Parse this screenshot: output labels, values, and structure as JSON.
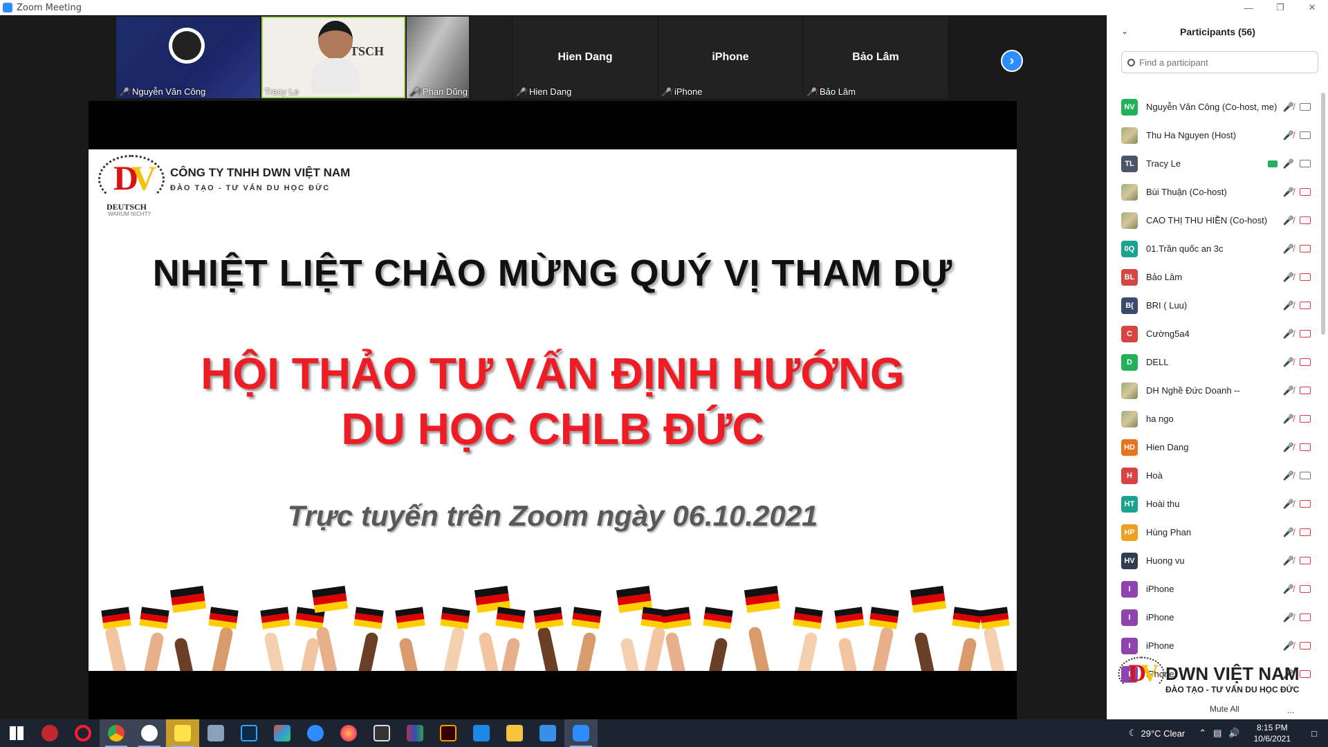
{
  "window": {
    "title": "Zoom Meeting"
  },
  "video_strip": [
    {
      "name": "Nguyễn Văn Công",
      "muted": true
    },
    {
      "name": "Tracy Le",
      "muted": false,
      "speaking": true,
      "overlay_text": "TSCH"
    },
    {
      "name": "Phan Dũng",
      "muted": true
    },
    {
      "name": "Hien Dang",
      "muted": true,
      "center_label": "Hien Dang"
    },
    {
      "name": "iPhone",
      "muted": true,
      "center_label": "iPhone"
    },
    {
      "name": "Bảo Lâm",
      "muted": true,
      "center_label": "Bảo Lâm"
    }
  ],
  "slide": {
    "company_name": "CÔNG TY TNHH DWN VIỆT NAM",
    "company_sub": "ĐÀO TẠO - TƯ VẤN DU HỌC ĐỨC",
    "logo_text": "DEUTSCH",
    "logo_sub": "WARUM NICHT?",
    "line1": "NHIỆT LIỆT CHÀO MỪNG  QUÝ  VỊ THAM DỰ",
    "line2a": "HỘI THẢO TƯ VẤN ĐỊNH HƯỚNG",
    "line2b": "DU HỌC CHLB ĐỨC",
    "line3": "Trực tuyến trên Zoom ngày 06.10.2021"
  },
  "participants_panel": {
    "title": "Participants (56)",
    "search_placeholder": "Find a participant",
    "participants": [
      {
        "initials": "NV",
        "color": "#23b05b",
        "name": "Nguyễn Văn Công (Co-host, me)",
        "video": "on"
      },
      {
        "initials": "",
        "color": "photo",
        "name": "Thu Ha Nguyen (Host)",
        "video": "on"
      },
      {
        "initials": "TL",
        "color": "#4a5568",
        "name": "Tracy Le",
        "video": "on",
        "sharing": true,
        "mic": "on"
      },
      {
        "initials": "",
        "color": "photo",
        "name": "Bùi Thuận (Co-host)",
        "video": "off"
      },
      {
        "initials": "",
        "color": "photo",
        "name": "CAO THỊ THU HIỀN (Co-host)",
        "video": "off"
      },
      {
        "initials": "0Q",
        "color": "#1aa391",
        "name": "01.Trần quốc an 3c",
        "video": "off"
      },
      {
        "initials": "BL",
        "color": "#d64541",
        "name": "Bảo Lâm",
        "video": "off"
      },
      {
        "initials": "B(",
        "color": "#3c4a6b",
        "name": "BRI ( Luu)",
        "video": "off"
      },
      {
        "initials": "C",
        "color": "#d64541",
        "name": "Cường5a4",
        "video": "off"
      },
      {
        "initials": "D",
        "color": "#23b05b",
        "name": "DELL",
        "video": "off"
      },
      {
        "initials": "",
        "color": "photo",
        "name": "DH Nghề Đức Doanh --",
        "video": "off"
      },
      {
        "initials": "",
        "color": "photo",
        "name": "ha ngo",
        "video": "off"
      },
      {
        "initials": "HD",
        "color": "#e8731f",
        "name": "Hien Dang",
        "video": "off"
      },
      {
        "initials": "H",
        "color": "#d64541",
        "name": "Hoà",
        "video": "on"
      },
      {
        "initials": "HT",
        "color": "#1aa391",
        "name": "Hoài thu",
        "video": "off"
      },
      {
        "initials": "HP",
        "color": "#f0a020",
        "name": "Hùng Phan",
        "video": "off"
      },
      {
        "initials": "HV",
        "color": "#2f3c52",
        "name": "Huong vu",
        "video": "off"
      },
      {
        "initials": "I",
        "color": "#8e44ad",
        "name": "iPhone",
        "video": "off"
      },
      {
        "initials": "I",
        "color": "#8e44ad",
        "name": "iPhone",
        "video": "off"
      },
      {
        "initials": "I",
        "color": "#8e44ad",
        "name": "iPhone",
        "video": "off"
      },
      {
        "initials": "I",
        "color": "#8e44ad",
        "name": "iPhone",
        "video": "off"
      }
    ],
    "mute_all_label": "Mute All",
    "more_label": "...",
    "watermark_title": "DWN VIỆT NAM",
    "watermark_sub": "ĐÀO TẠO - TƯ VẤN DU HỌC ĐỨC"
  },
  "taskbar": {
    "weather": "29°C  Clear",
    "time": "8:15 PM",
    "date": "10/6/2021"
  }
}
